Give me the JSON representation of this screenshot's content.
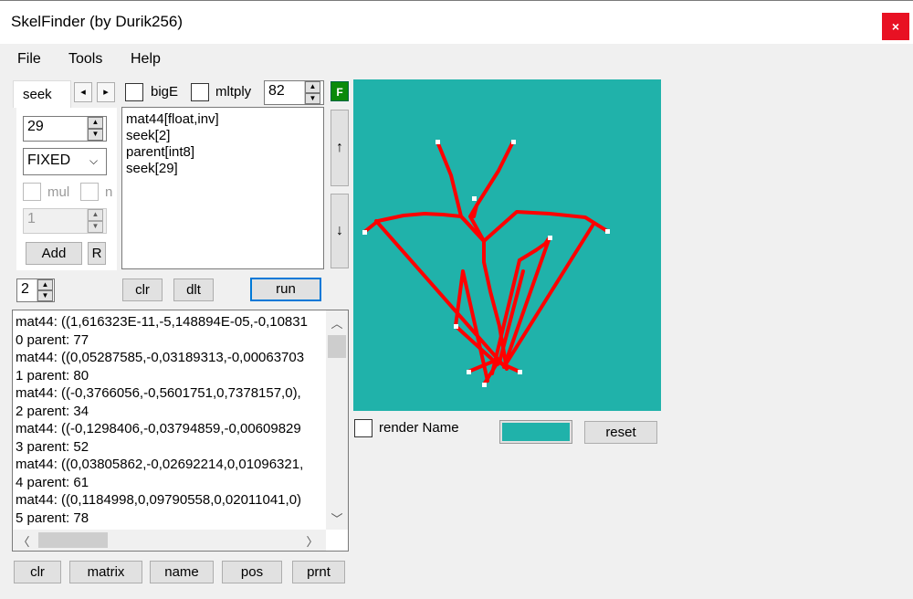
{
  "window": {
    "title": "SkelFinder (by Durik256)",
    "close_label": "×"
  },
  "menu": [
    "File",
    "Tools",
    "Help"
  ],
  "seek_tab": {
    "label": "seek",
    "nav_prev": "◂",
    "nav_next": "▸"
  },
  "options": {
    "bigE_label": "bigE",
    "mltply_label": "mltply",
    "count_value": "82",
    "flag_label": "F"
  },
  "left_panel": {
    "seek_value": "29",
    "type_value": "FIXED",
    "mul_label": "mul",
    "n_label": "n",
    "repeat_value": "1",
    "add_label": "Add",
    "r_label": "R",
    "step_value": "2"
  },
  "command_list": [
    "mat44[float,inv]",
    "seek[2]",
    "parent[int8]",
    "seek[29]"
  ],
  "list_buttons": {
    "up": "↑",
    "down": "↓",
    "clr": "clr",
    "dlt": "dlt",
    "run": "run"
  },
  "log_lines": [
    "mat44: ((1,616323E-11,-5,148894E-05,-0,10831",
    "0 parent: 77",
    "mat44: ((0,05287585,-0,03189313,-0,00063703",
    "1 parent: 80",
    "mat44: ((-0,3766056,-0,5601751,0,7378157,0),",
    "2 parent: 34",
    "mat44: ((-0,1298406,-0,03794859,-0,00609829",
    "3 parent: 52",
    "mat44: ((0,03805862,-0,02692214,0,01096321,",
    "4 parent: 61",
    "mat44: ((0,1184998,0,09790558,0,02011041,0)",
    "5 parent: 78"
  ],
  "bottom_buttons": [
    "clr",
    "matrix",
    "name",
    "pos",
    "prnt"
  ],
  "preview": {
    "background_color": "#20b2aa",
    "bone_color": "#ff0000",
    "render_name_label": "render Name",
    "reset_label": "reset"
  }
}
